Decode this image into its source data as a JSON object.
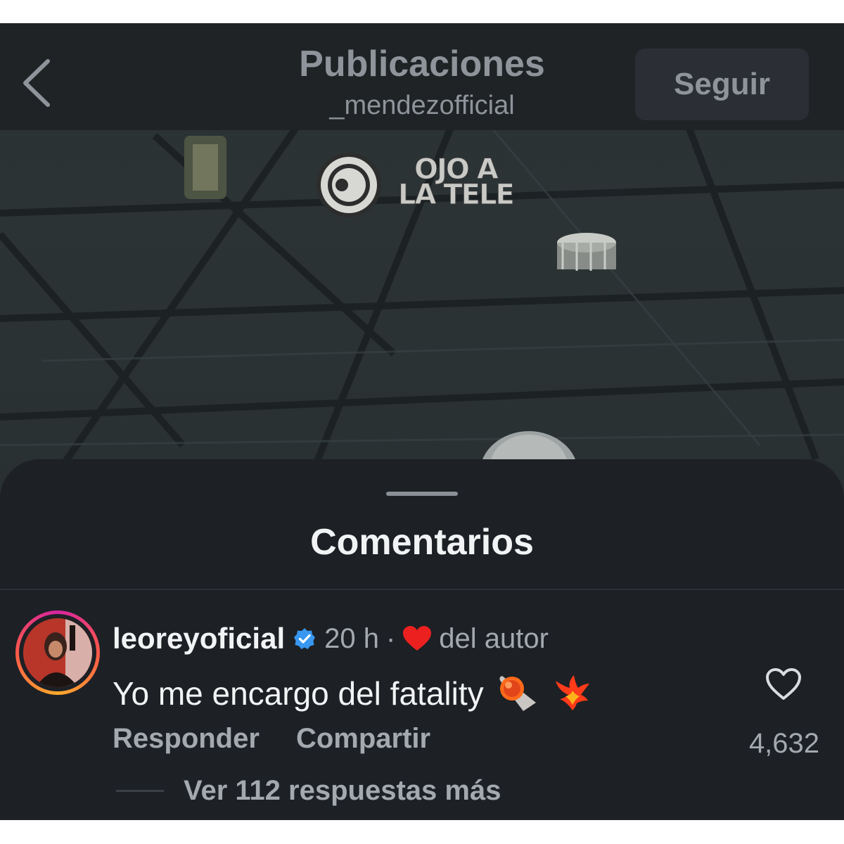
{
  "header": {
    "title": "Publicaciones",
    "subtitle": "_mendezofficial",
    "follow_label": "Seguir",
    "back_icon": "chevron-left-icon"
  },
  "video": {
    "logo_line1": "OJO A",
    "logo_line2": "LA TELE"
  },
  "comments_sheet": {
    "title": "Comentarios",
    "comment": {
      "username": "leoreyoficial",
      "verified": true,
      "time": "20 h",
      "separator": "·",
      "author_like": "del autor",
      "text": "Yo me encargo del fatality",
      "emojis": [
        "comet-icon",
        "phoenix-icon"
      ],
      "reply_label": "Responder",
      "share_label": "Compartir",
      "like_count": "4,632",
      "view_replies": "Ver 112 respuestas más"
    }
  },
  "colors": {
    "background": "#1d2025",
    "primary_text": "#f2f3f5",
    "secondary_text": "#a4a9af",
    "verified_blue": "#3897f0",
    "heart_red": "#ed2020"
  }
}
